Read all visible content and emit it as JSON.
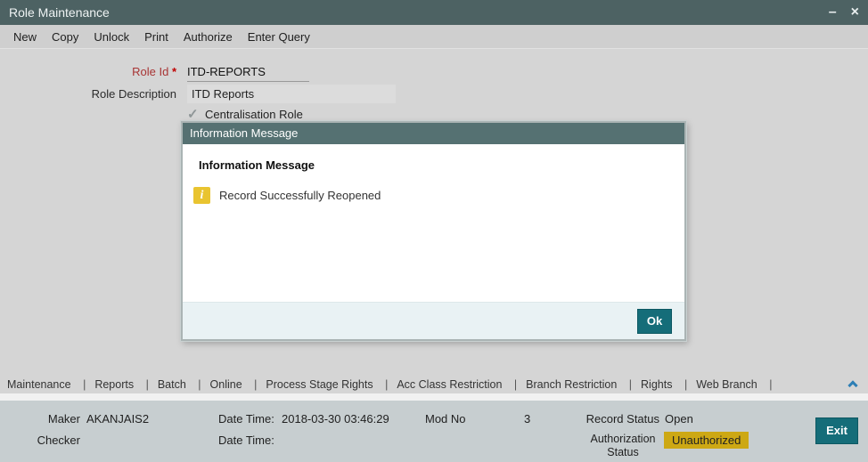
{
  "window": {
    "title": "Role Maintenance",
    "minimize_icon": "–",
    "close_icon": "×"
  },
  "toolbar": {
    "items": [
      "New",
      "Copy",
      "Unlock",
      "Print",
      "Authorize",
      "Enter Query"
    ]
  },
  "form": {
    "role_id": {
      "label": "Role Id",
      "required": "*",
      "value": "ITD-REPORTS"
    },
    "role_description": {
      "label": "Role Description",
      "value": "ITD Reports"
    },
    "centralisation": {
      "check": "✓",
      "label": "Centralisation Role"
    }
  },
  "modal": {
    "title": "Information Message",
    "heading": "Information Message",
    "icon_glyph": "i",
    "message": "Record Successfully Reopened",
    "ok": "Ok"
  },
  "tabs": {
    "items": [
      "Maintenance",
      "Reports",
      "Batch",
      "Online",
      "Process Stage Rights",
      "Acc Class Restriction",
      "Branch Restriction",
      "Rights",
      "Web Branch"
    ],
    "separator": "|"
  },
  "footer": {
    "maker": {
      "label": "Maker",
      "value": "AKANJAIS2"
    },
    "maker_datetime": {
      "label": "Date Time:",
      "value": "2018-03-30 03:46:29"
    },
    "mod_no": {
      "label": "Mod No",
      "value": "3"
    },
    "record_status": {
      "label": "Record Status",
      "value": "Open"
    },
    "checker": {
      "label": "Checker",
      "value": ""
    },
    "checker_datetime": {
      "label": "Date Time:",
      "value": ""
    },
    "auth_status": {
      "label": "Authorization Status",
      "value": "Unauthorized"
    },
    "exit": "Exit"
  },
  "colors": {
    "titlebar": "#4d6263",
    "modal_header": "#557172",
    "button_teal": "#156d79",
    "status_highlight": "#cda814",
    "info_icon": "#e9c430"
  }
}
